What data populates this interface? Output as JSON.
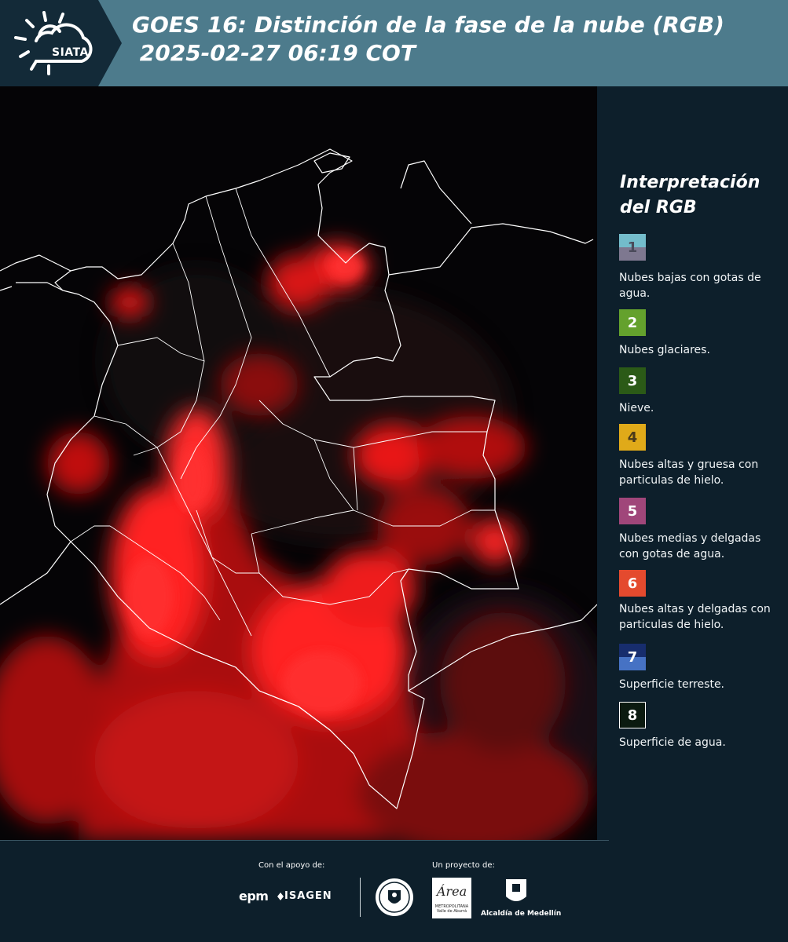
{
  "header": {
    "logo_text": "SIATA",
    "title": "GOES 16: Distinción de la fase de la nube (RGB)\n 2025-02-27 06:19 COT"
  },
  "legend": {
    "title": "Interpretación del RGB",
    "items": [
      {
        "number": "1",
        "label": "Nubes bajas con gotas de agua.",
        "top_color": "#73bccb",
        "bottom_color": "#7e7890",
        "text_color": "#4a4a5a"
      },
      {
        "number": "2",
        "label": "Nubes glaciares.",
        "top_color": "#64a12d",
        "bottom_color": "#64a12d",
        "text_color": "#ffffff"
      },
      {
        "number": "3",
        "label": "Nieve.",
        "top_color": "#2b5a17",
        "bottom_color": "#2b5a17",
        "text_color": "#ffffff"
      },
      {
        "number": "4",
        "label": "Nubes altas y gruesa con particulas de hielo.",
        "top_color": "#e0aa19",
        "bottom_color": "#e0aa19",
        "text_color": "#4a3a1a"
      },
      {
        "number": "5",
        "label": "Nubes medias y delgadas con gotas de agua.",
        "top_color": "#a0467a",
        "bottom_color": "#a0467a",
        "text_color": "#ffffff"
      },
      {
        "number": "6",
        "label": "Nubes altas y delgadas con particulas de hielo.",
        "top_color": "#e44a2e",
        "bottom_color": "#e44a2e",
        "text_color": "#ffffff"
      },
      {
        "number": "7",
        "label": "Superficie terreste.",
        "top_color": "#172d6d",
        "bottom_color": "#4672c4",
        "text_color": "#ffffff"
      },
      {
        "number": "8",
        "label": "Superficie de agua.",
        "top_color": "#0b1a10",
        "bottom_color": "#0b1a10",
        "text_color": "#ffffff"
      }
    ]
  },
  "footer": {
    "support_label": "Con el apoyo de:",
    "project_label": "Un proyecto de:",
    "epm": "epm",
    "isagen": "ISAGEN",
    "amva_mark": "Área",
    "amva_name": "METROPOLITANA Valle de Aburrá",
    "alcaldia": "Alcaldía de Medellín"
  },
  "colors": {
    "header_bg": "#4d7b8c",
    "header_dark": "#132a38",
    "panel_bg": "#0d1f2b",
    "cloud_red": "#ff1a1a"
  }
}
